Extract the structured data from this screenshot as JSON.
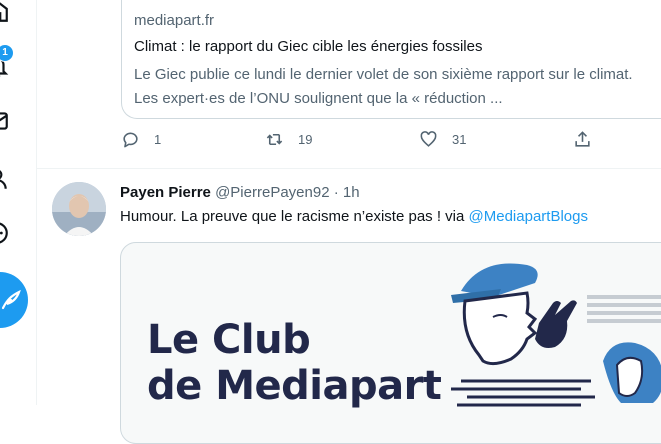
{
  "sidebar": {
    "notification_badge": "1",
    "icons": [
      "bell-icon",
      "mail-icon",
      "user-icon",
      "more-circle-icon"
    ],
    "tweet_button_icon": "feather-icon"
  },
  "link_card": {
    "domain": "mediapart.fr",
    "title": "Climat : le rapport du Giec cible les énergies fossiles",
    "description": "Le Giec publie ce lundi le dernier volet de son sixième rapport sur le climat. Les expert·es de l’ONU soulignent que la « réduction ..."
  },
  "actions": {
    "reply_count": "1",
    "retweet_count": "19",
    "like_count": "31"
  },
  "tweet": {
    "name": "Payen Pierre",
    "handle": "@PierrePayen92",
    "dot": "·",
    "time": "1h",
    "text": "Humour. La preuve que le racisme n’existe pas ! via ",
    "mention": "@MediapartBlogs",
    "media_title_line1": "Le Club",
    "media_title_line2": "de Mediapart"
  },
  "colors": {
    "accent": "#1d9bf0",
    "muted": "#536471",
    "text": "#0f1419",
    "club_navy": "#22284a"
  }
}
